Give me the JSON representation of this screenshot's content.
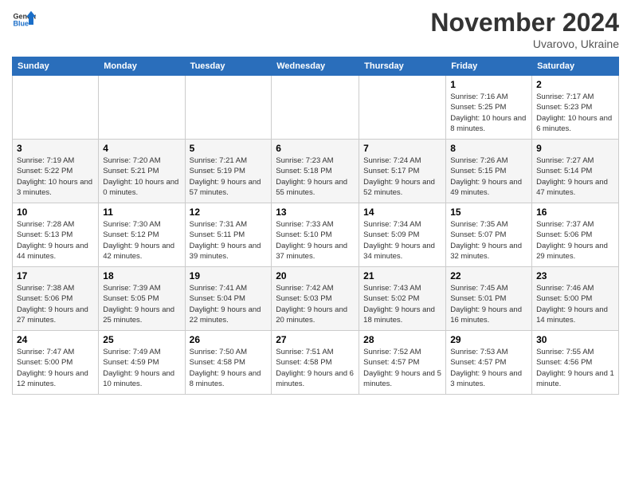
{
  "logo": {
    "text_general": "General",
    "text_blue": "Blue"
  },
  "header": {
    "month_year": "November 2024",
    "location": "Uvarovo, Ukraine"
  },
  "columns": [
    "Sunday",
    "Monday",
    "Tuesday",
    "Wednesday",
    "Thursday",
    "Friday",
    "Saturday"
  ],
  "weeks": [
    [
      {
        "day": "",
        "info": ""
      },
      {
        "day": "",
        "info": ""
      },
      {
        "day": "",
        "info": ""
      },
      {
        "day": "",
        "info": ""
      },
      {
        "day": "",
        "info": ""
      },
      {
        "day": "1",
        "info": "Sunrise: 7:16 AM\nSunset: 5:25 PM\nDaylight: 10 hours and 8 minutes."
      },
      {
        "day": "2",
        "info": "Sunrise: 7:17 AM\nSunset: 5:23 PM\nDaylight: 10 hours and 6 minutes."
      }
    ],
    [
      {
        "day": "3",
        "info": "Sunrise: 7:19 AM\nSunset: 5:22 PM\nDaylight: 10 hours and 3 minutes."
      },
      {
        "day": "4",
        "info": "Sunrise: 7:20 AM\nSunset: 5:21 PM\nDaylight: 10 hours and 0 minutes."
      },
      {
        "day": "5",
        "info": "Sunrise: 7:21 AM\nSunset: 5:19 PM\nDaylight: 9 hours and 57 minutes."
      },
      {
        "day": "6",
        "info": "Sunrise: 7:23 AM\nSunset: 5:18 PM\nDaylight: 9 hours and 55 minutes."
      },
      {
        "day": "7",
        "info": "Sunrise: 7:24 AM\nSunset: 5:17 PM\nDaylight: 9 hours and 52 minutes."
      },
      {
        "day": "8",
        "info": "Sunrise: 7:26 AM\nSunset: 5:15 PM\nDaylight: 9 hours and 49 minutes."
      },
      {
        "day": "9",
        "info": "Sunrise: 7:27 AM\nSunset: 5:14 PM\nDaylight: 9 hours and 47 minutes."
      }
    ],
    [
      {
        "day": "10",
        "info": "Sunrise: 7:28 AM\nSunset: 5:13 PM\nDaylight: 9 hours and 44 minutes."
      },
      {
        "day": "11",
        "info": "Sunrise: 7:30 AM\nSunset: 5:12 PM\nDaylight: 9 hours and 42 minutes."
      },
      {
        "day": "12",
        "info": "Sunrise: 7:31 AM\nSunset: 5:11 PM\nDaylight: 9 hours and 39 minutes."
      },
      {
        "day": "13",
        "info": "Sunrise: 7:33 AM\nSunset: 5:10 PM\nDaylight: 9 hours and 37 minutes."
      },
      {
        "day": "14",
        "info": "Sunrise: 7:34 AM\nSunset: 5:09 PM\nDaylight: 9 hours and 34 minutes."
      },
      {
        "day": "15",
        "info": "Sunrise: 7:35 AM\nSunset: 5:07 PM\nDaylight: 9 hours and 32 minutes."
      },
      {
        "day": "16",
        "info": "Sunrise: 7:37 AM\nSunset: 5:06 PM\nDaylight: 9 hours and 29 minutes."
      }
    ],
    [
      {
        "day": "17",
        "info": "Sunrise: 7:38 AM\nSunset: 5:06 PM\nDaylight: 9 hours and 27 minutes."
      },
      {
        "day": "18",
        "info": "Sunrise: 7:39 AM\nSunset: 5:05 PM\nDaylight: 9 hours and 25 minutes."
      },
      {
        "day": "19",
        "info": "Sunrise: 7:41 AM\nSunset: 5:04 PM\nDaylight: 9 hours and 22 minutes."
      },
      {
        "day": "20",
        "info": "Sunrise: 7:42 AM\nSunset: 5:03 PM\nDaylight: 9 hours and 20 minutes."
      },
      {
        "day": "21",
        "info": "Sunrise: 7:43 AM\nSunset: 5:02 PM\nDaylight: 9 hours and 18 minutes."
      },
      {
        "day": "22",
        "info": "Sunrise: 7:45 AM\nSunset: 5:01 PM\nDaylight: 9 hours and 16 minutes."
      },
      {
        "day": "23",
        "info": "Sunrise: 7:46 AM\nSunset: 5:00 PM\nDaylight: 9 hours and 14 minutes."
      }
    ],
    [
      {
        "day": "24",
        "info": "Sunrise: 7:47 AM\nSunset: 5:00 PM\nDaylight: 9 hours and 12 minutes."
      },
      {
        "day": "25",
        "info": "Sunrise: 7:49 AM\nSunset: 4:59 PM\nDaylight: 9 hours and 10 minutes."
      },
      {
        "day": "26",
        "info": "Sunrise: 7:50 AM\nSunset: 4:58 PM\nDaylight: 9 hours and 8 minutes."
      },
      {
        "day": "27",
        "info": "Sunrise: 7:51 AM\nSunset: 4:58 PM\nDaylight: 9 hours and 6 minutes."
      },
      {
        "day": "28",
        "info": "Sunrise: 7:52 AM\nSunset: 4:57 PM\nDaylight: 9 hours and 5 minutes."
      },
      {
        "day": "29",
        "info": "Sunrise: 7:53 AM\nSunset: 4:57 PM\nDaylight: 9 hours and 3 minutes."
      },
      {
        "day": "30",
        "info": "Sunrise: 7:55 AM\nSunset: 4:56 PM\nDaylight: 9 hours and 1 minute."
      }
    ]
  ]
}
